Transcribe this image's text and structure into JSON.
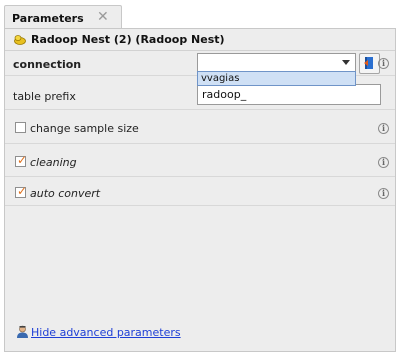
{
  "tab": {
    "title": "Parameters",
    "close_glyph": "✕"
  },
  "operator": {
    "title": "Radoop Nest (2) (Radoop Nest)",
    "icon": "nest-icon"
  },
  "params": {
    "connection": {
      "label": "connection",
      "value": "",
      "dropdown_option": "vvagias",
      "button_icon": "connection-manager-icon"
    },
    "table_prefix": {
      "label": "table prefix",
      "value": "radoop_"
    },
    "change_sample_size": {
      "label": "change sample size",
      "checked": false
    },
    "cleaning": {
      "label": "cleaning",
      "checked": true,
      "check_glyph": "✓"
    },
    "auto_convert": {
      "label": "auto convert",
      "checked": true,
      "check_glyph": "✓"
    }
  },
  "info_glyph": "i",
  "advanced": {
    "link_label": "Hide advanced parameters",
    "icon": "expert-user-icon"
  },
  "colors": {
    "check": "#e0701b",
    "link": "#1f3fd6",
    "selection": "#cfe0f5"
  }
}
